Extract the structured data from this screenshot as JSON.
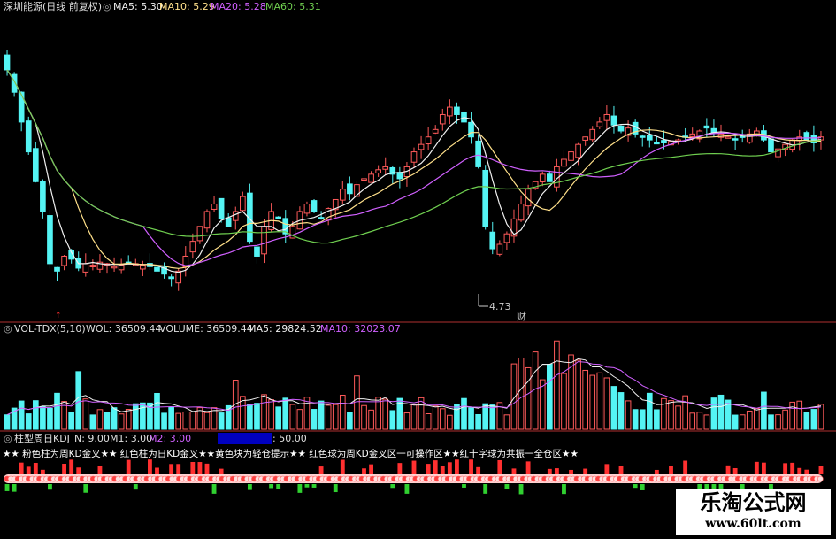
{
  "colors": {
    "up": "#ff5a5a",
    "down": "#54f4f4",
    "ma5": "#f0f0f0",
    "ma10": "#ffe08a",
    "ma20": "#d060ff",
    "ma60": "#70d050",
    "frame": "#b03030",
    "pink": "#ff7ab0",
    "kdj_red": "#ff3030",
    "kdj_green": "#30d030"
  },
  "header": {
    "stock": "深圳能源(日线 前复权)",
    "ma5": "MA5: 5.30",
    "ma10": "MA10: 5.29",
    "ma20": "MA20: 5.28",
    "ma60": "MA60: 5.31"
  },
  "price_panel": {
    "low_marker": "4.73",
    "cai_marker": "财",
    "chart_data": {
      "type": "candlestick",
      "series_names": [
        "MA5",
        "MA10",
        "MA20",
        "MA60"
      ],
      "y_range": [
        4.6,
        6.5
      ],
      "closes": [
        6.15,
        6.0,
        5.8,
        5.6,
        5.4,
        5.2,
        4.85,
        4.8,
        4.9,
        4.88,
        4.82,
        4.85,
        4.84,
        4.86,
        4.85,
        4.83,
        4.84,
        4.86,
        4.85,
        4.84,
        4.83,
        4.8,
        4.78,
        4.75,
        4.8,
        4.9,
        5.0,
        5.1,
        5.2,
        5.25,
        5.15,
        5.1,
        5.2,
        5.3,
        5.0,
        4.9,
        5.1,
        5.2,
        5.15,
        5.05,
        5.1,
        5.2,
        5.25,
        5.2,
        5.15,
        5.22,
        5.28,
        5.35,
        5.32,
        5.38,
        5.42,
        5.45,
        5.48,
        5.5,
        5.45,
        5.42,
        5.5,
        5.6,
        5.65,
        5.7,
        5.75,
        5.85,
        5.9,
        5.85,
        5.8,
        5.7,
        5.5,
        5.1,
        4.95,
        4.98,
        5.05,
        5.15,
        5.25,
        5.35,
        5.4,
        5.45,
        5.4,
        5.5,
        5.55,
        5.6,
        5.65,
        5.7,
        5.75,
        5.8,
        5.85,
        5.78,
        5.74,
        5.76,
        5.72,
        5.7,
        5.68,
        5.66,
        5.66,
        5.67,
        5.68,
        5.7,
        5.72,
        5.74,
        5.76,
        5.73,
        5.72,
        5.7,
        5.68,
        5.7,
        5.72,
        5.74,
        5.68,
        5.6,
        5.62,
        5.65,
        5.68,
        5.7,
        5.68,
        5.66,
        5.7
      ]
    }
  },
  "volume_panel": {
    "title": "VOL-TDX(5,10)",
    "wol": "WOL: 36509.44",
    "volume": "VOLUME: 36509.44",
    "ma5": "MA5: 29824.52",
    "ma10": "MA10: 32023.07"
  },
  "kdj_panel": {
    "title": "柱型周日KDJ",
    "n": "N: 9.00",
    "m1": "M1: 3.00",
    "m2": "M2: 3.00",
    "extra": ": 50.00",
    "legend": "★★ 粉色柱为周KD金叉★★ 红色柱为日KD金叉★★黄色块为轻仓提示★★ 红色球为周KD金叉区一可操作区★★红十字球为共振一全仓区★★"
  },
  "watermark": {
    "line1": "乐淘公式网",
    "line2": "www.60lt.com"
  }
}
